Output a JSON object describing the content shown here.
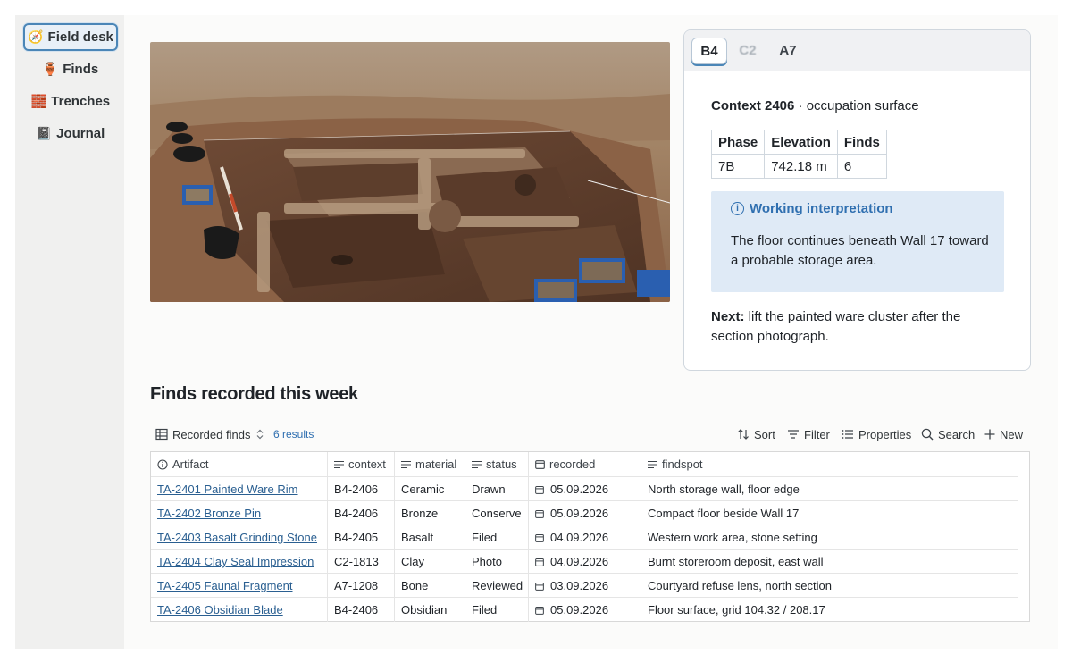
{
  "sidebar": {
    "items": [
      {
        "icon": "compass-icon",
        "glyph": "🧭",
        "label": "Field desk"
      },
      {
        "icon": "amphora-icon",
        "glyph": "🏺",
        "label": "Finds"
      },
      {
        "icon": "bricks-icon",
        "glyph": "🧱",
        "label": "Trenches"
      },
      {
        "icon": "notebook-icon",
        "glyph": "📓",
        "label": "Journal"
      }
    ]
  },
  "panel": {
    "tabs": [
      "B4",
      "C2",
      "A7"
    ],
    "context_label": "Context 2406",
    "context_sub": " · occupation surface",
    "meta_headers": [
      "Phase",
      "Elevation",
      "Finds"
    ],
    "meta_values": [
      "7B",
      "742.18 m",
      "6"
    ],
    "callout_title": "Working interpretation",
    "callout_body": "The floor continues beneath Wall 17 toward a probable storage area.",
    "next_label": "Next:",
    "next_text": " lift the painted ware cluster after the section photograph."
  },
  "finds": {
    "title": "Finds recorded this week",
    "view_label": "Recorded finds",
    "count": "6 results",
    "actions": {
      "sort": "Sort",
      "filter": "Filter",
      "properties": "Properties",
      "search": "Search",
      "new": "New"
    },
    "columns": [
      "Artifact",
      "context",
      "material",
      "status",
      "recorded",
      "findspot"
    ],
    "rows": [
      {
        "artifact": "TA-2401 Painted Ware Rim",
        "context": "B4-2406",
        "material": "Ceramic",
        "status": "Drawn",
        "recorded": "05.09.2026",
        "findspot": "North storage wall, floor edge"
      },
      {
        "artifact": "TA-2402 Bronze Pin",
        "context": "B4-2406",
        "material": "Bronze",
        "status": "Conserve",
        "recorded": "05.09.2026",
        "findspot": "Compact floor beside Wall 17"
      },
      {
        "artifact": "TA-2403 Basalt Grinding Stone",
        "context": "B4-2405",
        "material": "Basalt",
        "status": "Filed",
        "recorded": "04.09.2026",
        "findspot": "Western work area, stone setting"
      },
      {
        "artifact": "TA-2404 Clay Seal Impression",
        "context": "C2-1813",
        "material": "Clay",
        "status": "Photo",
        "recorded": "04.09.2026",
        "findspot": "Burnt storeroom deposit, east wall"
      },
      {
        "artifact": "TA-2405 Faunal Fragment",
        "context": "A7-1208",
        "material": "Bone",
        "status": "Reviewed",
        "recorded": "03.09.2026",
        "findspot": "Courtyard refuse lens, north section"
      },
      {
        "artifact": "TA-2406 Obsidian Blade",
        "context": "B4-2406",
        "material": "Obsidian",
        "status": "Filed",
        "recorded": "05.09.2026",
        "findspot": "Floor surface, grid 104.32 / 208.17"
      }
    ]
  }
}
